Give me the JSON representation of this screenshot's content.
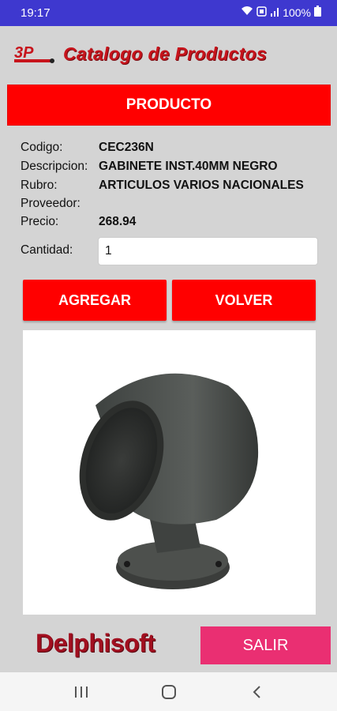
{
  "status_bar": {
    "time": "19:17",
    "battery": "100%"
  },
  "header": {
    "logo_text": "3P",
    "title": "Catalogo de Productos"
  },
  "banner": {
    "label": "PRODUCTO"
  },
  "product": {
    "codigo_label": "Codigo:",
    "codigo_value": "CEC236N",
    "descripcion_label": "Descripcion:",
    "descripcion_value": "GABINETE INST.40MM NEGRO",
    "rubro_label": "Rubro:",
    "rubro_value": "ARTICULOS VARIOS NACIONALES",
    "proveedor_label": "Proveedor:",
    "proveedor_value": "",
    "precio_label": "Precio:",
    "precio_value": "268.94"
  },
  "quantity": {
    "label": "Cantidad:",
    "value": "1"
  },
  "actions": {
    "agregar_label": "AGREGAR",
    "volver_label": "VOLVER",
    "salir_label": "SALIR"
  },
  "footer": {
    "brand": "Delphisoft"
  },
  "colors": {
    "status_bar": "#3e38cf",
    "banner_red": "#ff0000",
    "title_red": "#c7141c",
    "salir_pink": "#ea2f72",
    "background": "#d4d4d4"
  },
  "icons": {
    "status": [
      "wifi-icon",
      "data-icon",
      "signal-icon",
      "battery-icon"
    ],
    "nav": [
      "recent-apps-icon",
      "home-icon",
      "back-icon"
    ]
  }
}
